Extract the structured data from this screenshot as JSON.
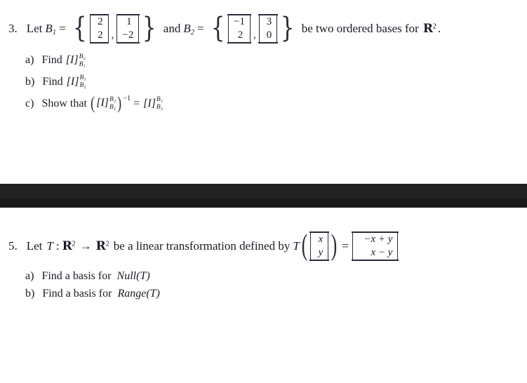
{
  "document": {
    "background_color": "#ffffff",
    "text_color": "#1a1a24"
  },
  "separator": {
    "upper_color": "#212121",
    "lower_color": "#1a1a1a"
  },
  "problem_3": {
    "number": "3.",
    "lead": "Let",
    "basis1_name": "B",
    "basis1_sub": "1",
    "equals": "=",
    "basis1_vectors": [
      {
        "top": "2",
        "bottom": "2"
      },
      {
        "top": "1",
        "bottom": "−2"
      }
    ],
    "conjunction": "and",
    "basis2_name": "B",
    "basis2_sub": "2",
    "basis2_vectors": [
      {
        "top": "−1",
        "bottom": "2"
      },
      {
        "top": "3",
        "bottom": "0"
      }
    ],
    "tail": "be two ordered bases for",
    "field_symbol": "R",
    "field_exponent": "2",
    "period": ".",
    "comma": ",",
    "brace_open": "{",
    "brace_close": "}",
    "parts": [
      {
        "label": "a)",
        "text": "Find",
        "matrix_symbol": "I",
        "upper_index": "B₂",
        "lower_index": "B₁"
      },
      {
        "label": "b)",
        "text": "Find",
        "matrix_symbol": "I",
        "upper_index": "B₁",
        "lower_index": "B₂"
      },
      {
        "label": "c)",
        "text": "Show that",
        "lhs_symbol": "I",
        "lhs_upper": "B₂",
        "lhs_lower": "B₁",
        "inverse_exponent": "−1",
        "relation": "=",
        "rhs_symbol": "I",
        "rhs_upper": "B₁",
        "rhs_lower": "B₂",
        "paren_open": "(",
        "paren_close": ")"
      }
    ]
  },
  "problem_5": {
    "number": "5.",
    "lead": "Let",
    "transform_name": "T",
    "colon": ":",
    "domain_symbol": "R",
    "domain_exponent": "2",
    "arrow": "→",
    "codomain_symbol": "R",
    "codomain_exponent": "2",
    "middle": "be a linear transformation defined by",
    "applied_name": "T",
    "paren_open": "(",
    "paren_close": ")",
    "input_vector": {
      "top": "x",
      "bottom": "y"
    },
    "equals": "=",
    "output_vector": {
      "top": "−x + y",
      "bottom": "x − y"
    },
    "parts": [
      {
        "label": "a)",
        "text": "Find a basis for",
        "expression": "Null(T)"
      },
      {
        "label": "b)",
        "text": "Find a basis for",
        "expression": "Range(T)"
      }
    ]
  }
}
